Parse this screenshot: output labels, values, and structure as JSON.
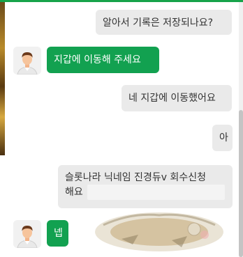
{
  "messages": [
    {
      "id": "m1",
      "sender": "user",
      "text": "알아서 기록은 저장되나요?"
    },
    {
      "id": "m2",
      "sender": "bot",
      "text": "지갑에 이동해 주세요"
    },
    {
      "id": "m3",
      "sender": "user",
      "text": "네 지갑에 이동했어요"
    },
    {
      "id": "m4",
      "sender": "user",
      "text": "아"
    },
    {
      "id": "m5",
      "sender": "user",
      "line1": "슬롯나라 닉네임 진경듀v 회수신청",
      "line2": "해요"
    },
    {
      "id": "m6",
      "sender": "bot",
      "text": "넵"
    }
  ],
  "colors": {
    "accent": "#17a34a",
    "bot_bubble": "#12a150",
    "user_bubble": "#eaeaea"
  },
  "icons": {
    "avatar": "person-avatar-icon"
  }
}
